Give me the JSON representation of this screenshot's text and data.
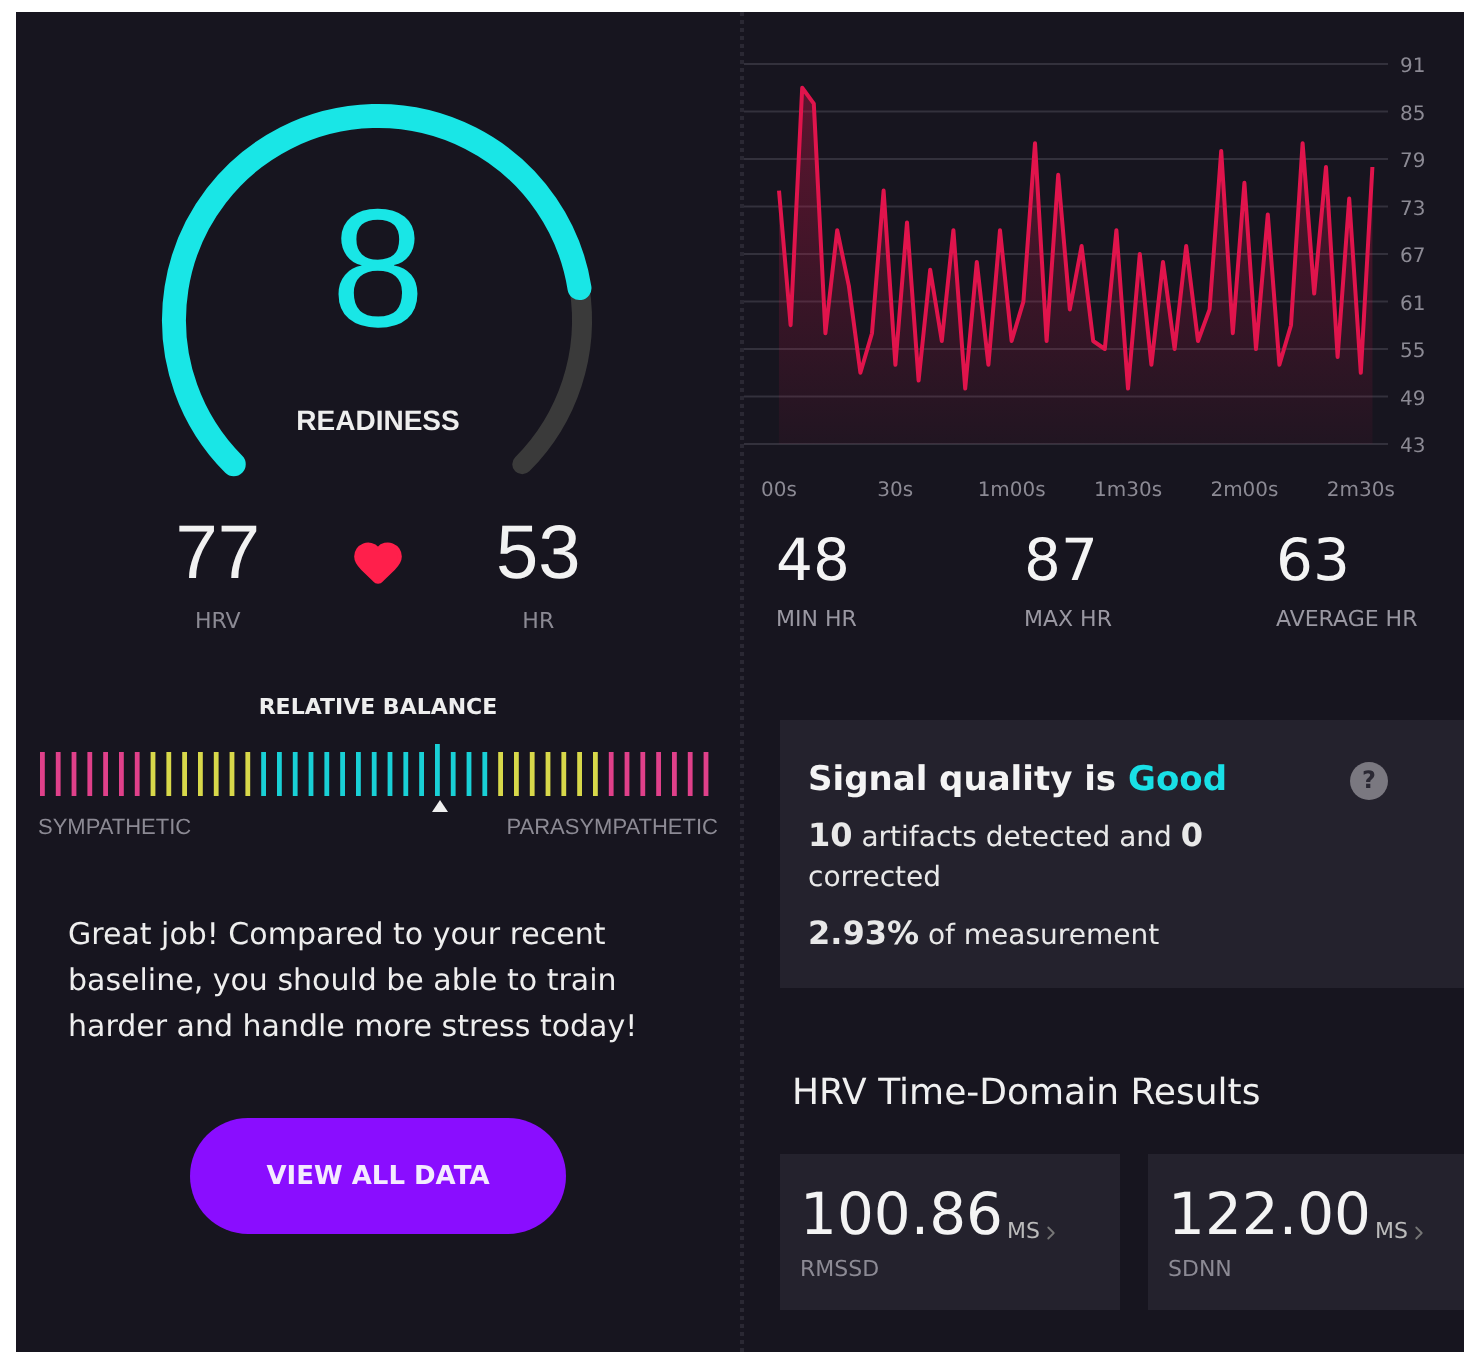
{
  "readiness": {
    "score": "8",
    "label": "READINESS"
  },
  "vitals": [
    {
      "value": "77",
      "label": "HRV"
    },
    {
      "value": "53",
      "label": "HR"
    }
  ],
  "balance": {
    "title": "RELATIVE BALANCE",
    "left_label": "SYMPATHETIC",
    "right_label": "PARASYMPATHETIC"
  },
  "message": "Great job! Compared to your recent baseline, you should be able to train harder and handle more stress today!",
  "button": "VIEW ALL DATA",
  "chart_data": {
    "type": "area",
    "grid": true,
    "x": [
      0,
      3,
      6,
      9,
      12,
      15,
      18,
      21,
      24,
      27,
      30,
      33,
      36,
      39,
      42,
      45,
      48,
      51,
      54,
      57,
      60,
      63,
      66,
      69,
      72,
      75,
      78,
      81,
      84,
      87,
      90,
      93,
      96,
      99,
      102,
      105,
      108,
      111,
      114,
      117,
      120,
      123,
      126,
      129,
      132,
      135,
      138,
      141,
      144,
      147,
      150,
      153
    ],
    "series": [
      {
        "color": "#e0144c",
        "values": [
          75,
          58,
          88,
          86,
          57,
          70,
          63,
          52,
          57,
          75,
          53,
          71,
          51,
          65,
          56,
          70,
          50,
          66,
          53,
          70,
          56,
          61,
          81,
          56,
          77,
          60,
          68,
          56,
          55,
          70,
          50,
          67,
          53,
          66,
          55,
          68,
          56,
          60,
          80,
          57,
          76,
          55,
          72,
          53,
          58,
          81,
          62,
          78,
          54,
          74,
          52,
          78
        ]
      }
    ],
    "xlim": [
      -9,
      157
    ],
    "ylim": [
      43,
      91
    ],
    "xticks": [
      {
        "value": 0,
        "label": "00s"
      },
      {
        "value": 30,
        "label": "30s"
      },
      {
        "value": 60,
        "label": "1m00s"
      },
      {
        "value": 90,
        "label": "1m30s"
      },
      {
        "value": 120,
        "label": "2m00s"
      },
      {
        "value": 150,
        "label": "2m30s"
      }
    ],
    "yticks": [
      43,
      49,
      55,
      61,
      67,
      73,
      79,
      85,
      91
    ]
  },
  "hr_stats": [
    {
      "value": "48",
      "label": "MIN HR"
    },
    {
      "value": "87",
      "label": "MAX HR"
    },
    {
      "value": "63",
      "label": "AVERAGE HR"
    }
  ],
  "signal_quality": {
    "title": "Signal quality is",
    "status": "Good",
    "help": "?",
    "artifacts": "**10** artifacts detected and **0** corrected",
    "share": "**2.93%** of measurement"
  },
  "results": {
    "title": "HRV Time-Domain Results",
    "cards": [
      {
        "value": "100.86",
        "unit": "MS",
        "label": "RMSSD"
      },
      {
        "value": "122.00",
        "unit": "MS",
        "label": "SDNN"
      }
    ]
  }
}
